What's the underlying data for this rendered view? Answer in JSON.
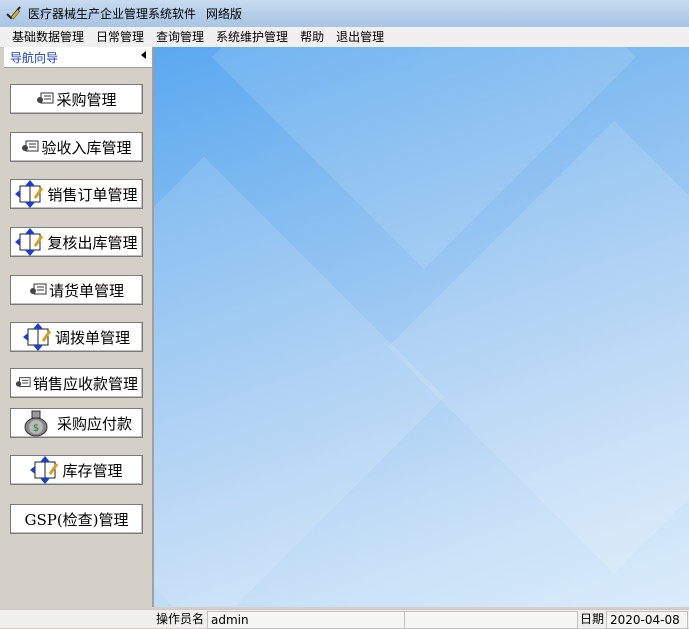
{
  "window": {
    "title": "医疗器械生产企业管理系统软件",
    "edition": "网络版",
    "icon": "pen-check-icon"
  },
  "menu": [
    {
      "label": "基础数据管理"
    },
    {
      "label": "日常管理"
    },
    {
      "label": "查询管理"
    },
    {
      "label": "系统维护管理"
    },
    {
      "label": "帮助"
    },
    {
      "label": "退出管理"
    }
  ],
  "nav": {
    "header": "导航向导",
    "items": [
      {
        "label": "采购管理",
        "icon": "form-card-icon"
      },
      {
        "label": "验收入库管理",
        "icon": "form-card-icon"
      },
      {
        "label": "销售订单管理",
        "icon": "arrows-book-icon"
      },
      {
        "label": "复核出库管理",
        "icon": "arrows-book-icon"
      },
      {
        "label": "请货单管理",
        "icon": "form-card-icon"
      },
      {
        "label": "调拨单管理",
        "icon": "arrows-book-icon"
      },
      {
        "label": "销售应收款管理",
        "icon": "form-card-icon"
      },
      {
        "label": "采购应付款",
        "icon": "money-bag-icon"
      },
      {
        "label": "库存管理",
        "icon": "arrows-book-icon"
      },
      {
        "label": "GSP(检查)管理",
        "icon": ""
      }
    ]
  },
  "status": {
    "operator_label": "操作员名",
    "operator_value": "admin",
    "date_label": "日期",
    "date_value": "2020-04-08"
  },
  "colors": {
    "nav_header_text": "#1a3fbf",
    "workspace_blue": "#5aa8f0"
  }
}
